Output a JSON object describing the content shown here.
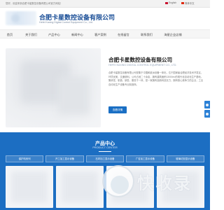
{
  "topbar": {
    "welcome": "您好，欢迎来到合肥卡星数控设备有限公司官方网站！",
    "lang_en": "English",
    "lang_cn": "简体中文"
  },
  "header": {
    "company_cn": "合肥卡星数控设备有限公司",
    "company_en": "Hefei Kaxing Digital Control Equipment Co., Ltd."
  },
  "nav": {
    "items": [
      "首页",
      "关于我们",
      "产品中心",
      "新闻中心",
      "客户案例",
      "在线留言",
      "联系我们",
      "海星企业店铺"
    ]
  },
  "about": {
    "title": "合肥卡星数控设备有限公司",
    "subtitle_en": "HEFEI KAXING DIGITAL CONTROL EQUIPMENT CO., LTD.",
    "paragraph": "合肥卡星数控设备有限公司是集于中国和欧洲设备一体化，位于国家级合肥经济技术开发区，环境优美，交通便利。公司占地二十余亩，拥有建筑面积13000m²的现代化自动化生产基地。集研发、制造、销售、服务于一体，是一家拥有高新科技实力，拥有核心竞争力的企业，工业自动化生产设备专业制造商。",
    "more_label": "查看详情"
  },
  "products": {
    "title": "产品中心",
    "subtitle": "PRODUCT CENTER",
    "categories": [
      "保护机系列",
      "开工加工显示设备",
      "石材加工显示设备",
      "广告加工显示设备",
      "玻璃切割显示设备"
    ]
  },
  "watermark": {
    "text": "快收录"
  }
}
